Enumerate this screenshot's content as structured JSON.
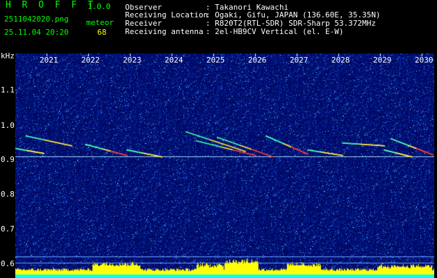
{
  "app": {
    "name": "H R O F F T",
    "version": "1.0.0"
  },
  "file": {
    "name": "2511042020.png",
    "datetime": "25.11.04 20:20"
  },
  "meteor": {
    "label": "meteor",
    "count": "68"
  },
  "info": [
    {
      "key": "Observer",
      "value": ": Takanori Kawachi"
    },
    {
      "key": "Receiving Location",
      "value": ": Ogaki, Gifu, JAPAN (136.60E, 35.35N)"
    },
    {
      "key": "Receiver",
      "value": ": R820T2(RTL-SDR) SDR-Sharp 53.372MHz"
    },
    {
      "key": "Receiving antenna",
      "value": ": 2el-HB9CV Vertical (el. E-W)"
    }
  ],
  "yaxis": {
    "unit": "kHz",
    "ticks": [
      "1.1",
      "1.0",
      "0.9",
      "0.8",
      "0.7",
      "0.6"
    ]
  },
  "xaxis": {
    "ticks": [
      "2021",
      "2022",
      "2023",
      "2024",
      "2025",
      "2026",
      "2027",
      "2028",
      "2029",
      "2030"
    ]
  },
  "colors": {
    "title": "#00ff00",
    "info": "#ffffff",
    "meteor_count": "#ffff00",
    "background": "#000a66",
    "level_bar": "#ffff00",
    "baseline": "#00ffff"
  }
}
